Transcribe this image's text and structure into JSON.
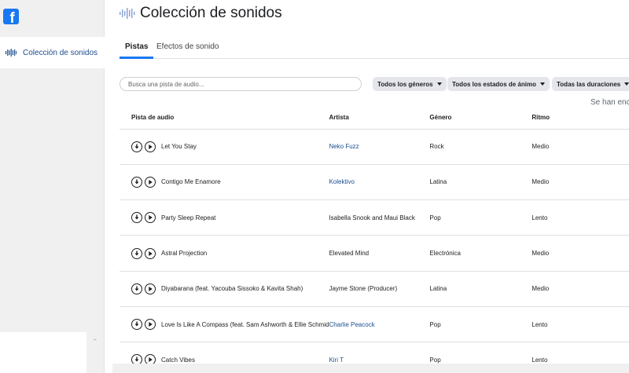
{
  "sidebar": {
    "logo": "f",
    "items": [
      {
        "label": "Colección de sonidos",
        "icon": "sound-wave-icon"
      }
    ]
  },
  "page": {
    "title": "Colección de sonidos"
  },
  "tabs": [
    {
      "label": "Pistas",
      "active": true
    },
    {
      "label": "Efectos de sonido",
      "active": false
    }
  ],
  "search": {
    "placeholder": "Busca una pista de audio..."
  },
  "filters": [
    {
      "label": "Todos los géneros"
    },
    {
      "label": "Todos los estados de ánimo"
    },
    {
      "label": "Todas las duraciones"
    }
  ],
  "notice": "Se han enc",
  "table": {
    "headers": [
      "Pista de audio",
      "Artista",
      "Género",
      "Ritmo"
    ],
    "rows": [
      {
        "track": "Let You Stay",
        "artist": "Neko Fuzz",
        "genre": "Rock",
        "tempo": "Medio",
        "artist_link": true
      },
      {
        "track": "Contigo Me Enamore",
        "artist": "Kolektivo",
        "genre": "Latina",
        "tempo": "Medio",
        "artist_link": true
      },
      {
        "track": "Party Sleep Repeat",
        "artist": "Isabella Snook and Maui Black",
        "genre": "Pop",
        "tempo": "Lento",
        "artist_link": false
      },
      {
        "track": "Astral Projection",
        "artist": "Elevated Mind",
        "genre": "Electrónica",
        "tempo": "Medio",
        "artist_link": false
      },
      {
        "track": "Diyabarana (feat. Yacouba Sissoko & Kavita Shah)",
        "artist": "Jayme Stone (Producer)",
        "genre": "Latina",
        "tempo": "Medio",
        "artist_link": false
      },
      {
        "track": "Love Is Like A Compass (feat. Sam Ashworth & Ellie Schmid",
        "artist": "Charlie Peacock",
        "genre": "Pop",
        "tempo": "Lento",
        "artist_link": true
      },
      {
        "track": "Catch Vibes",
        "artist": "Kiri T",
        "genre": "Pop",
        "tempo": "Lento",
        "artist_link": true
      }
    ]
  },
  "colors": {
    "brand": "#1877f2",
    "link": "#1d4e8f",
    "sidebar_bg": "#f0f0f0"
  }
}
